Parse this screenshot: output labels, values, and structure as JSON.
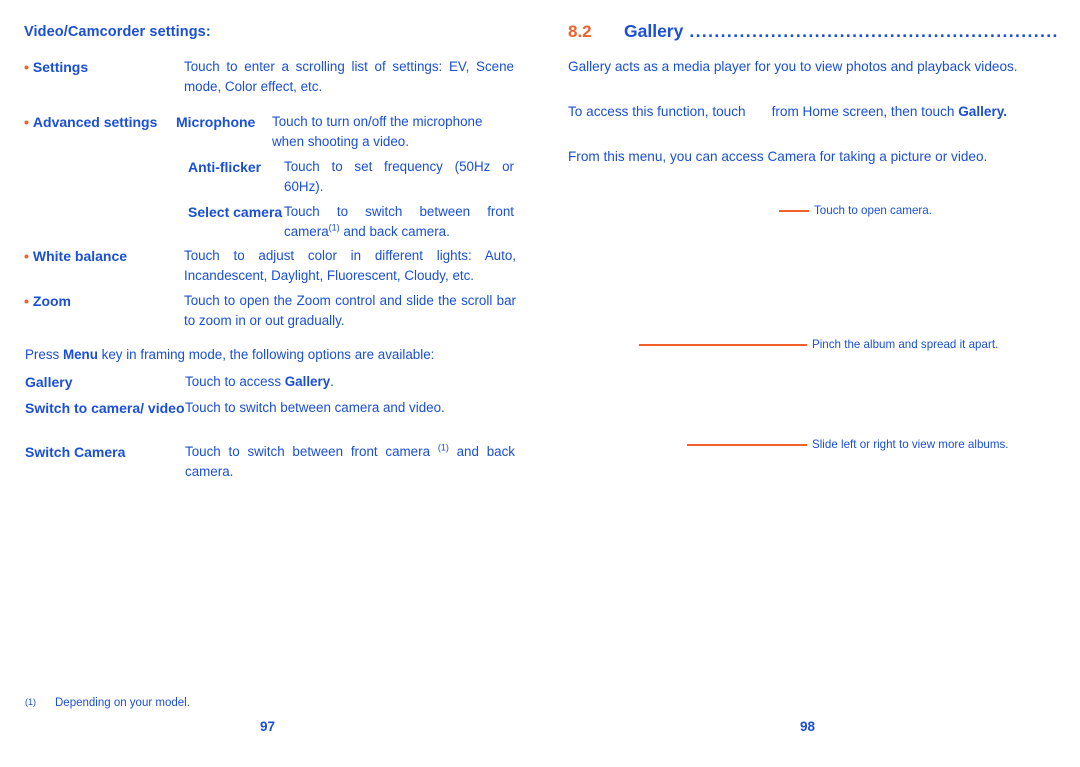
{
  "left_page": {
    "section_heading": "Video/Camcorder settings:",
    "rows": [
      {
        "bullet": "•",
        "term": "Settings",
        "sub_term": "",
        "desc": "Touch to enter a scrolling list of settings: EV, Scene mode, Color effect, etc."
      },
      {
        "bullet": "•",
        "term": "Advanced settings",
        "sub_term": "Microphone",
        "desc": "Touch to turn on/off the microphone when shooting a video."
      },
      {
        "bullet": "",
        "term": "",
        "sub_term": "Anti-flicker",
        "desc": "Touch to set frequency (50Hz or 60Hz)."
      },
      {
        "bullet": "",
        "term": "",
        "sub_term": "Select camera",
        "desc_pre": "Touch to switch between front camera",
        "desc_sup": "(1)",
        "desc_post": " and back camera."
      },
      {
        "bullet": "•",
        "term": "White balance",
        "sub_term": "",
        "desc": "Touch to adjust color in different lights: Auto, Incandescent, Daylight, Fluorescent, Cloudy, etc."
      },
      {
        "bullet": "•",
        "term": "Zoom",
        "sub_term": "",
        "desc": "Touch to open the Zoom control and slide the scroll bar to zoom in or out gradually."
      }
    ],
    "menu_intro_pre": "Press ",
    "menu_intro_bold": "Menu",
    "menu_intro_post": " key in framing mode, the following options are available:",
    "menu_rows": [
      {
        "term": "Gallery",
        "desc_pre": "Touch to access ",
        "desc_bold": "Gallery",
        "desc_post": "."
      },
      {
        "term": "Switch to camera/ video",
        "desc_pre": "Touch to switch between camera and video.",
        "desc_bold": "",
        "desc_post": ""
      },
      {
        "term": "Switch Camera",
        "desc_pre": "Touch to switch between front camera ",
        "desc_sup": "(1)",
        "desc_post": " and back camera."
      }
    ],
    "footnote_mark": "(1)",
    "footnote_text": "Depending on your model.",
    "page_number": "97"
  },
  "right_page": {
    "chapter_number": "8.2",
    "chapter_title": "Gallery",
    "dot_fill": "...............................................................",
    "paragraph_1": "Gallery acts as a media player for you to view photos and playback videos.",
    "paragraph_2_pre": "To access this function, touch",
    "paragraph_2_mid": "from Home screen, then touch",
    "paragraph_2_bold": "Gallery.",
    "paragraph_3": "From this menu, you can access Camera for taking a picture or video.",
    "callouts": [
      {
        "text": "Touch to open camera."
      },
      {
        "text": "Pinch the album and spread it apart."
      },
      {
        "text": "Slide left or right to view more albums."
      }
    ],
    "page_number": "98"
  },
  "colors": {
    "blue": "#1a4fd6",
    "orange": "#f4602a",
    "background": "#ffffff"
  }
}
